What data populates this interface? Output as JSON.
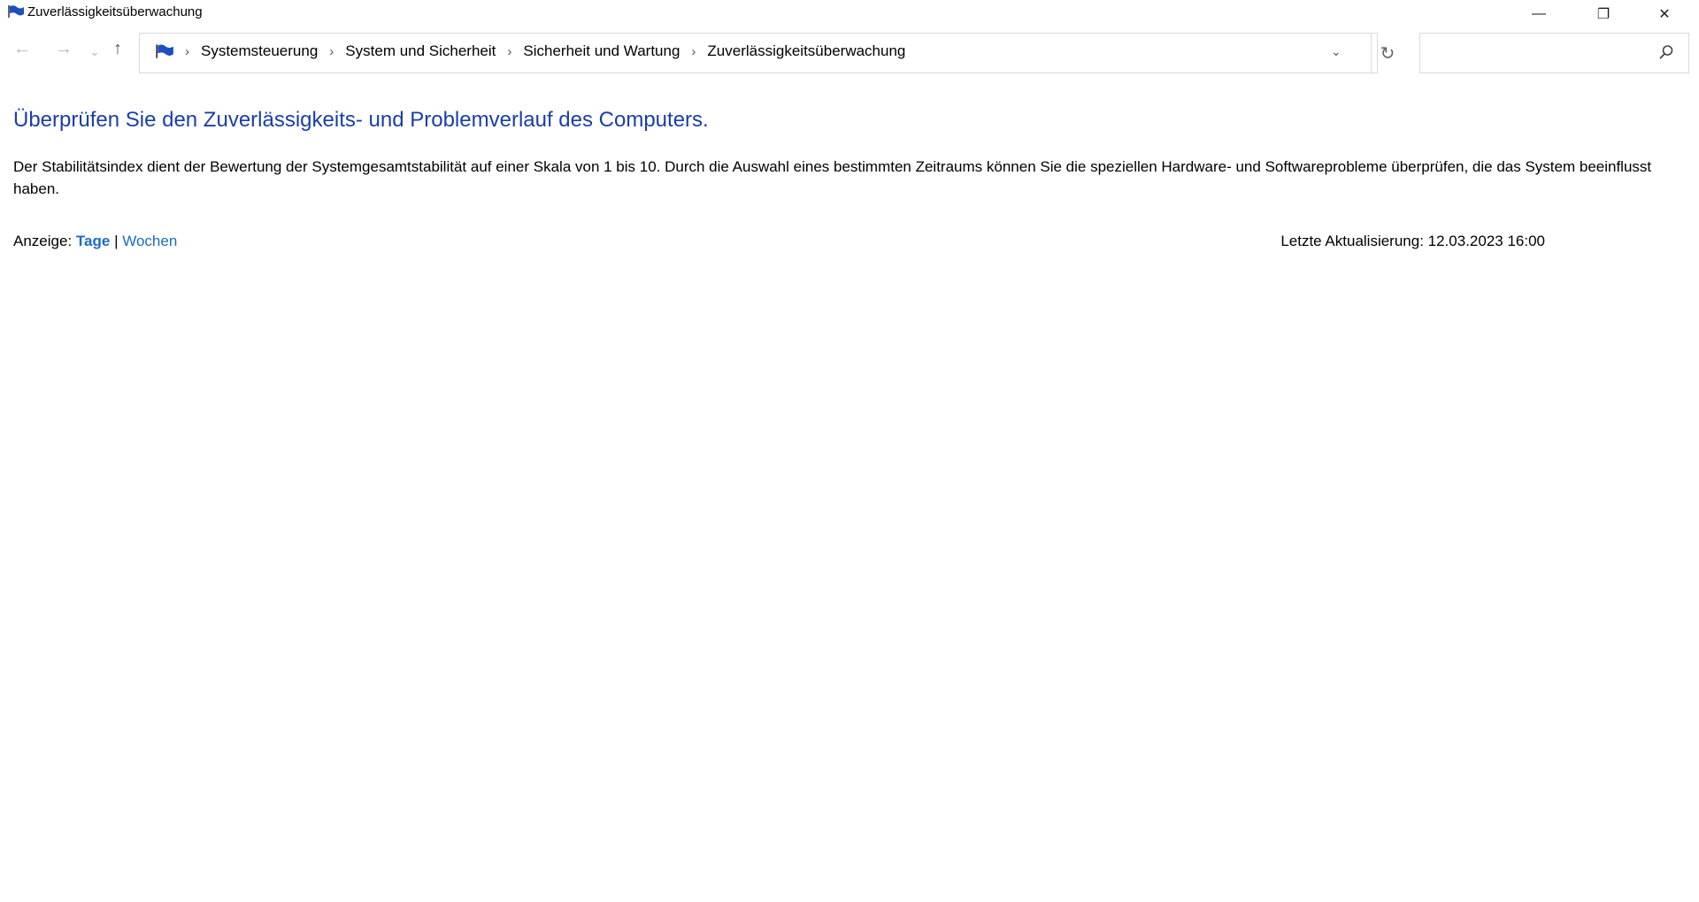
{
  "window": {
    "title": "Zuverlässigkeitsüberwachung",
    "buttons": {
      "minimize": "—",
      "maximize": "❐",
      "close": "✕"
    }
  },
  "nav": {
    "back": "←",
    "forward": "→",
    "recent": "⌄",
    "up": "↑",
    "refresh": "↻",
    "dropdown": "⌄"
  },
  "breadcrumb": [
    "Systemsteuerung",
    "System und Sicherheit",
    "Sicherheit und Wartung",
    "Zuverlässigkeitsüberwachung"
  ],
  "search": {
    "placeholder": ""
  },
  "heading": "Überprüfen Sie den Zuverlässigkeits- und Problemverlauf des Computers.",
  "description": "Der Stabilitätsindex dient der Bewertung der Systemgesamtstabilität auf einer Skala von 1 bis 10. Durch die Auswahl eines bestimmten Zeitraums können Sie die speziellen Hardware- und Softwareprobleme überprüfen, die das System beeinflusst haben.",
  "view": {
    "label": "Anzeige:",
    "days": "Tage",
    "divider": "|",
    "weeks": "Wochen"
  },
  "last_update": "Letzte Aktualisierung: 12.03.2023 16:00",
  "colors": {
    "heading": "#1a3fa8",
    "link": "#1a6bc7"
  }
}
